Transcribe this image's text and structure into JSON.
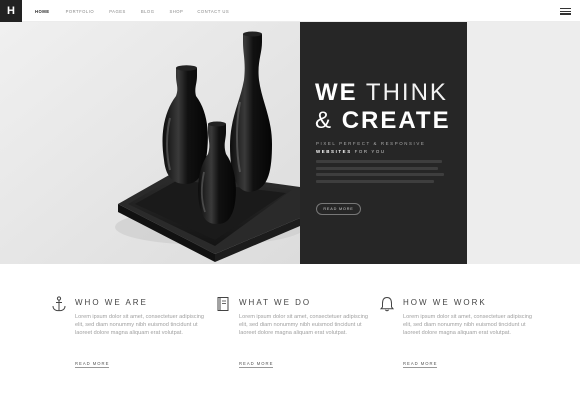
{
  "nav": {
    "logo": "H",
    "items": [
      {
        "label": "HOME"
      },
      {
        "label": "PORTFOLIO"
      },
      {
        "label": "PAGES"
      },
      {
        "label": "BLOG"
      },
      {
        "label": "SHOP"
      },
      {
        "label": "CONTACT US"
      }
    ],
    "active_index": 0,
    "menu_icon": "hamburger-icon"
  },
  "hero": {
    "headline": {
      "we": "WE",
      "think": "THINK",
      "amp": "&",
      "create": "CREATE"
    },
    "subtitle_line1": "PIXEL PERFECT & RESPONSIVE",
    "subtitle_line2_bold": "WEBSITES",
    "subtitle_line2_rest": "FOR YOU",
    "button_label": "READ MORE",
    "panel_color": "#262626"
  },
  "features": [
    {
      "icon": "anchor-icon",
      "title": "WHO WE ARE",
      "text": "Lorem ipsum dolor sit amet, consectetuer adipiscing elit, sed diam nonummy nibh euismod tincidunt ut laoreet dolore magna aliquam erat volutpat.",
      "link": "READ MORE"
    },
    {
      "icon": "book-icon",
      "title": "WHAT WE DO",
      "text": "Lorem ipsum dolor sit amet, consectetuer adipiscing elit, sed diam nonummy nibh euismod tincidunt ut laoreet dolore magna aliquam erat volutpat.",
      "link": "READ MORE"
    },
    {
      "icon": "bell-icon",
      "title": "HOW WE WORK",
      "text": "Lorem ipsum dolor sit amet, consectetuer adipiscing elit, sed diam nonummy nibh euismod tincidunt ut laoreet dolore magna aliquam erat volutpat.",
      "link": "READ MORE"
    }
  ]
}
